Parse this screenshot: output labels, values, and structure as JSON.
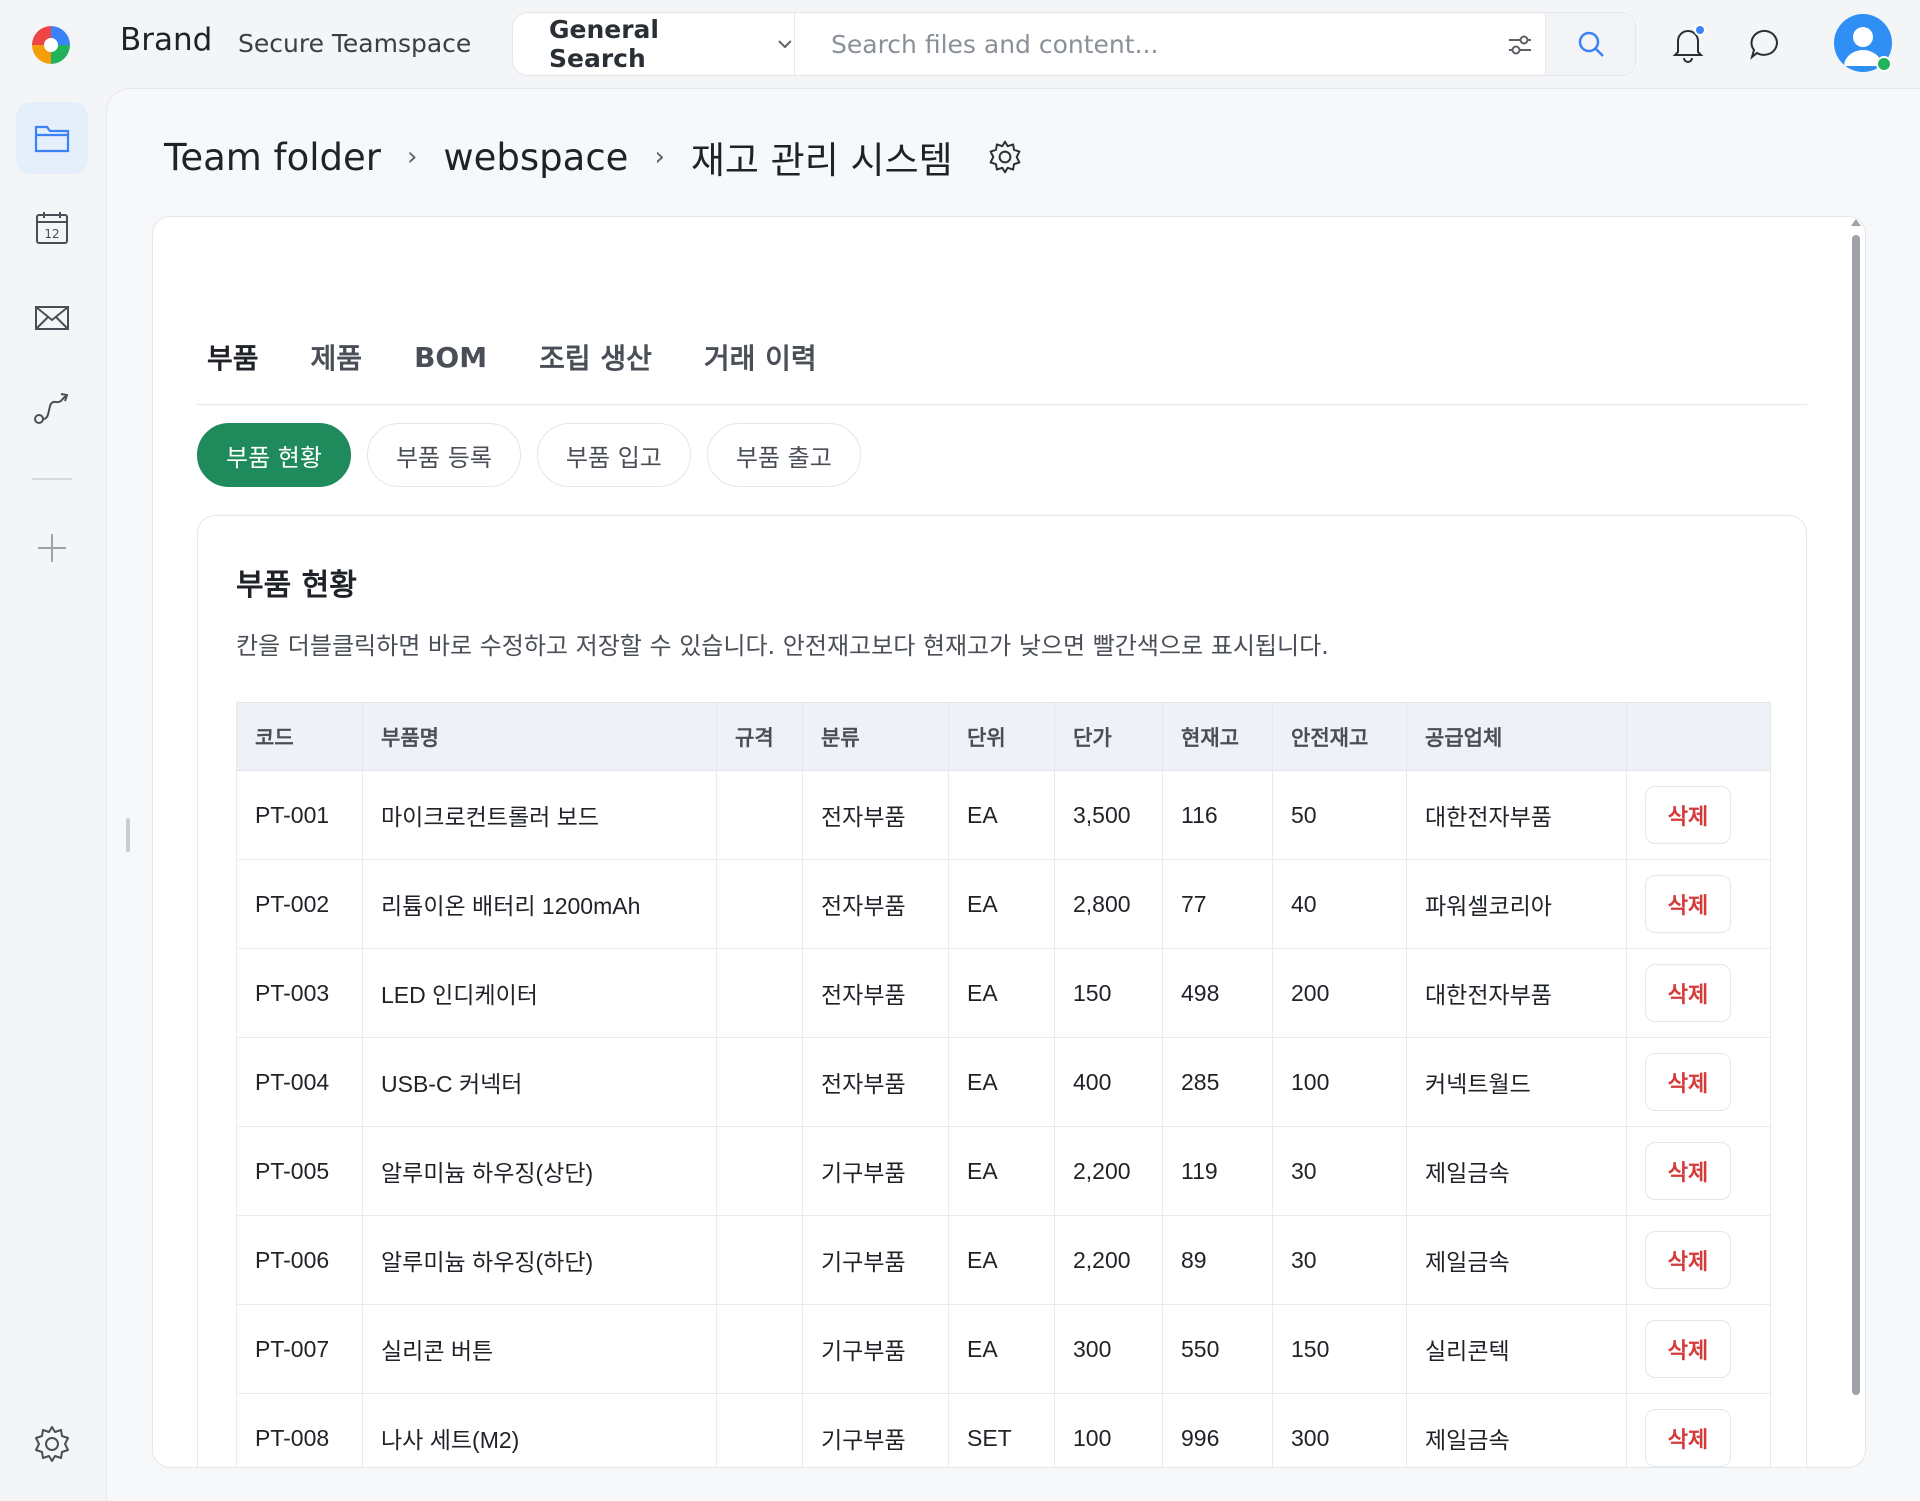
{
  "app": {
    "brand": "Brand",
    "workspace": "Secure Teamspace"
  },
  "search": {
    "type_label": "General Search",
    "placeholder": "Search files and content..."
  },
  "breadcrumb": {
    "items": [
      "Team folder",
      "webspace",
      "재고 관리 시스템"
    ]
  },
  "tabs": [
    "부품",
    "제품",
    "BOM",
    "조립 생산",
    "거래 이력"
  ],
  "active_tab": "부품",
  "subtabs": [
    "부품 현황",
    "부품 등록",
    "부품 입고",
    "부품 출고"
  ],
  "active_subtab": "부품 현황",
  "panel": {
    "title": "부품 현황",
    "description": "칸을 더블클릭하면 바로 수정하고 저장할 수 있습니다. 안전재고보다 현재고가 낮으면 빨간색으로 표시됩니다."
  },
  "table": {
    "headers": [
      "코드",
      "부품명",
      "규격",
      "분류",
      "단위",
      "단가",
      "현재고",
      "안전재고",
      "공급업체",
      ""
    ],
    "delete_label": "삭제",
    "rows": [
      [
        "PT-001",
        "마이크로컨트롤러 보드",
        "",
        "전자부품",
        "EA",
        "3,500",
        "116",
        "50",
        "대한전자부품"
      ],
      [
        "PT-002",
        "리튬이온 배터리 1200mAh",
        "",
        "전자부품",
        "EA",
        "2,800",
        "77",
        "40",
        "파워셀코리아"
      ],
      [
        "PT-003",
        "LED 인디케이터",
        "",
        "전자부품",
        "EA",
        "150",
        "498",
        "200",
        "대한전자부품"
      ],
      [
        "PT-004",
        "USB-C 커넥터",
        "",
        "전자부품",
        "EA",
        "400",
        "285",
        "100",
        "커넥트월드"
      ],
      [
        "PT-005",
        "알루미늄 하우징(상단)",
        "",
        "기구부품",
        "EA",
        "2,200",
        "119",
        "30",
        "제일금속"
      ],
      [
        "PT-006",
        "알루미늄 하우징(하단)",
        "",
        "기구부품",
        "EA",
        "2,200",
        "89",
        "30",
        "제일금속"
      ],
      [
        "PT-007",
        "실리콘 버튼",
        "",
        "기구부품",
        "EA",
        "300",
        "550",
        "150",
        "실리콘텍"
      ],
      [
        "PT-008",
        "나사 세트(M2)",
        "",
        "기구부품",
        "SET",
        "100",
        "996",
        "300",
        "제일금속"
      ]
    ]
  },
  "colors": {
    "accent_green": "#1f8a5b",
    "danger_red": "#d63b3b",
    "primary_blue": "#2f8ff5"
  },
  "icons": {
    "sidebar": [
      "folder-icon",
      "calendar-icon",
      "mail-icon",
      "route-icon",
      "plus-icon",
      "settings-icon"
    ],
    "calendar_day": "12"
  }
}
